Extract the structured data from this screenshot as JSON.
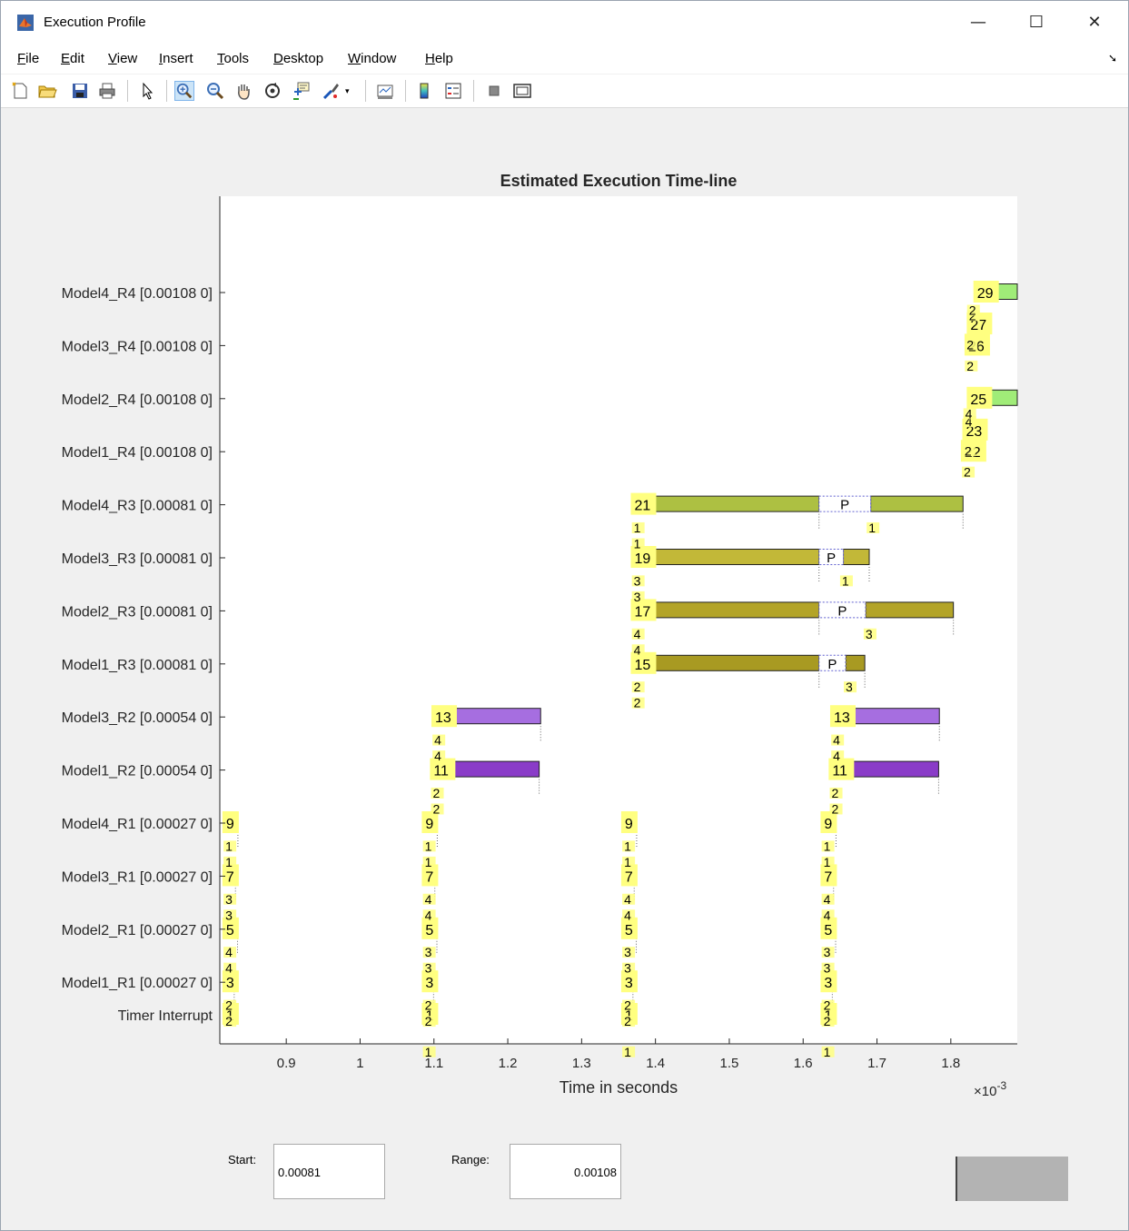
{
  "window": {
    "title": "Execution Profile",
    "controls": [
      "—",
      "☐",
      "✕"
    ]
  },
  "menu": [
    "File",
    "Edit",
    "View",
    "Insert",
    "Tools",
    "Desktop",
    "Window",
    "Help"
  ],
  "toolbar_icons": [
    "new-figure-icon",
    "open-file-icon",
    "save-icon",
    "print-icon",
    "edit-plot-icon",
    "zoom-in-icon",
    "zoom-out-icon",
    "pan-icon",
    "rotate-3d-icon",
    "data-cursor-icon",
    "brush-icon",
    "brush-dropdown-icon",
    "link-plot-icon",
    "insert-colorbar-icon",
    "insert-legend-icon",
    "hide-plot-tools-icon",
    "show-plot-tools-icon"
  ],
  "chart_data": {
    "type": "timeline",
    "title": "Estimated Execution Time-line",
    "xlabel": "Time in seconds",
    "x_multiplier": "×10^{-3}",
    "xlim": [
      0.81,
      1.89
    ],
    "xticks": [
      0.9,
      1,
      1.1,
      1.2,
      1.3,
      1.4,
      1.5,
      1.6,
      1.7,
      1.8
    ],
    "rows": [
      "Model4_R4 [0.00108 0]",
      "Model3_R4 [0.00108 0]",
      "Model2_R4 [0.00108 0]",
      "Model1_R4 [0.00108 0]",
      "Model4_R3 [0.00081 0]",
      "Model3_R3 [0.00081 0]",
      "Model2_R3 [0.00081 0]",
      "Model1_R3 [0.00081 0]",
      "Model3_R2 [0.00054 0]",
      "Model1_R2 [0.00054 0]",
      "Model4_R1 [0.00027 0]",
      "Model3_R1 [0.00027 0]",
      "Model2_R1 [0.00027 0]",
      "Model1_R1 [0.00027 0]",
      "Timer Interrupt"
    ],
    "colors": {
      "R1": "#b040a8",
      "R1b": "#8a3cc8",
      "R2": "#a66ee0",
      "R3a": "#a89a22",
      "R3b": "#b3a428",
      "R3c": "#c2b838",
      "R3d": "#adc042",
      "R4": "#a0ec78",
      "label_bg": "#ffff80"
    },
    "segments": [
      {
        "row": 10,
        "start": 0.8235,
        "end": 0.8345,
        "color": "R1b"
      },
      {
        "row": 11,
        "start": 0.8235,
        "end": 0.8312,
        "color": "R1"
      },
      {
        "row": 12,
        "start": 0.8235,
        "end": 0.834,
        "color": "R1"
      },
      {
        "row": 13,
        "start": 0.8235,
        "end": 0.8295,
        "color": "R1"
      },
      {
        "row": 10,
        "start": 1.0935,
        "end": 1.1045,
        "color": "R1b"
      },
      {
        "row": 11,
        "start": 1.0935,
        "end": 1.1012,
        "color": "R1"
      },
      {
        "row": 12,
        "start": 1.0935,
        "end": 1.104,
        "color": "R1"
      },
      {
        "row": 13,
        "start": 1.0935,
        "end": 1.0995,
        "color": "R1"
      },
      {
        "row": 9,
        "start": 1.104,
        "end": 1.2425,
        "color": "R1b"
      },
      {
        "row": 8,
        "start": 1.106,
        "end": 1.2445,
        "color": "R2"
      },
      {
        "row": 10,
        "start": 1.3635,
        "end": 1.3745,
        "color": "R1b"
      },
      {
        "row": 11,
        "start": 1.3635,
        "end": 1.3712,
        "color": "R1"
      },
      {
        "row": 12,
        "start": 1.3635,
        "end": 1.374,
        "color": "R1"
      },
      {
        "row": 13,
        "start": 1.3635,
        "end": 1.3695,
        "color": "R1"
      },
      {
        "row": 7,
        "start": 1.3765,
        "end": 1.6215,
        "color": "R3a"
      },
      {
        "row": 7,
        "start": 1.6575,
        "end": 1.6835,
        "color": "R3a"
      },
      {
        "row": 6,
        "start": 1.3765,
        "end": 1.6215,
        "color": "R3b"
      },
      {
        "row": 6,
        "start": 1.6845,
        "end": 1.8035,
        "color": "R3b"
      },
      {
        "row": 5,
        "start": 1.3765,
        "end": 1.6215,
        "color": "R3c"
      },
      {
        "row": 5,
        "start": 1.6545,
        "end": 1.6895,
        "color": "R3c"
      },
      {
        "row": 4,
        "start": 1.3765,
        "end": 1.6215,
        "color": "R3d"
      },
      {
        "row": 4,
        "start": 1.6915,
        "end": 1.8165,
        "color": "R3d"
      },
      {
        "row": 10,
        "start": 1.6335,
        "end": 1.6445,
        "color": "R1b"
      },
      {
        "row": 11,
        "start": 1.6335,
        "end": 1.6412,
        "color": "R1"
      },
      {
        "row": 12,
        "start": 1.6335,
        "end": 1.644,
        "color": "R1"
      },
      {
        "row": 13,
        "start": 1.6335,
        "end": 1.6395,
        "color": "R1"
      },
      {
        "row": 9,
        "start": 1.6445,
        "end": 1.7835,
        "color": "R1b"
      },
      {
        "row": 8,
        "start": 1.646,
        "end": 1.7845,
        "color": "R2"
      },
      {
        "row": 2,
        "start": 1.8405,
        "end": 1.89,
        "color": "R4"
      },
      {
        "row": 0,
        "start": 1.8505,
        "end": 1.89,
        "color": "R4"
      }
    ],
    "preempt_boxes": [
      {
        "row": 7,
        "start": 1.6215,
        "end": 1.6575,
        "label": "P"
      },
      {
        "row": 6,
        "start": 1.6215,
        "end": 1.6845,
        "label": "P"
      },
      {
        "row": 5,
        "start": 1.6215,
        "end": 1.6545,
        "label": "P"
      },
      {
        "row": 4,
        "start": 1.6215,
        "end": 1.6915,
        "label": "P"
      }
    ],
    "task_labels": [
      {
        "x": 0.8185,
        "yrow": 10,
        "text": "9"
      },
      {
        "x": 0.8185,
        "yrow": 11,
        "text": "7"
      },
      {
        "x": 0.8185,
        "yrow": 12,
        "text": "5"
      },
      {
        "x": 0.8185,
        "yrow": 13,
        "text": "3"
      },
      {
        "x": 0.8185,
        "yrow": 14,
        "text": "1"
      },
      {
        "x": 1.0885,
        "yrow": 10,
        "text": "9"
      },
      {
        "x": 1.0885,
        "yrow": 11,
        "text": "7"
      },
      {
        "x": 1.0885,
        "yrow": 12,
        "text": "5"
      },
      {
        "x": 1.0885,
        "yrow": 13,
        "text": "3"
      },
      {
        "x": 1.0885,
        "yrow": 14,
        "text": "1"
      },
      {
        "x": 1.0995,
        "yrow": 9,
        "text": "11"
      },
      {
        "x": 1.1015,
        "yrow": 8,
        "text": "13"
      },
      {
        "x": 1.3585,
        "yrow": 10,
        "text": "9"
      },
      {
        "x": 1.3585,
        "yrow": 11,
        "text": "7"
      },
      {
        "x": 1.3585,
        "yrow": 12,
        "text": "5"
      },
      {
        "x": 1.3585,
        "yrow": 13,
        "text": "3"
      },
      {
        "x": 1.3585,
        "yrow": 14,
        "text": "1"
      },
      {
        "x": 1.3715,
        "yrow": 7,
        "text": "15"
      },
      {
        "x": 1.3715,
        "yrow": 6,
        "text": "17"
      },
      {
        "x": 1.3715,
        "yrow": 5,
        "text": "19"
      },
      {
        "x": 1.3715,
        "yrow": 4,
        "text": "21"
      },
      {
        "x": 1.6285,
        "yrow": 10,
        "text": "9"
      },
      {
        "x": 1.6285,
        "yrow": 11,
        "text": "7"
      },
      {
        "x": 1.6285,
        "yrow": 12,
        "text": "5"
      },
      {
        "x": 1.6285,
        "yrow": 13,
        "text": "3"
      },
      {
        "x": 1.6285,
        "yrow": 14,
        "text": "1"
      },
      {
        "x": 1.6395,
        "yrow": 9,
        "text": "11"
      },
      {
        "x": 1.6415,
        "yrow": 8,
        "text": "13"
      },
      {
        "x": 1.8185,
        "yrow": 3.0,
        "text": "22"
      },
      {
        "x": 1.8205,
        "yrow": 2.6,
        "text": "23"
      },
      {
        "x": 1.8265,
        "yrow": 2.0,
        "text": "25"
      },
      {
        "x": 1.8235,
        "yrow": 1.0,
        "text": "26"
      },
      {
        "x": 1.8265,
        "yrow": 0.6,
        "text": "27"
      },
      {
        "x": 1.8355,
        "yrow": 0.0,
        "text": "29"
      }
    ],
    "sub_labels": [
      {
        "x": 0.8175,
        "yrow": 10.4,
        "text": "1"
      },
      {
        "x": 0.8175,
        "yrow": 11.4,
        "text": "3"
      },
      {
        "x": 0.8175,
        "yrow": 12.4,
        "text": "4"
      },
      {
        "x": 0.8175,
        "yrow": 13.4,
        "text": "2"
      },
      {
        "x": 0.8175,
        "yrow": 10.7,
        "text": "1"
      },
      {
        "x": 0.8175,
        "yrow": 11.7,
        "text": "3"
      },
      {
        "x": 0.8175,
        "yrow": 12.7,
        "text": "4"
      },
      {
        "x": 0.8175,
        "yrow": 13.7,
        "text": "2"
      },
      {
        "x": 1.0875,
        "yrow": 10.4,
        "text": "1"
      },
      {
        "x": 1.0875,
        "yrow": 11.4,
        "text": "4"
      },
      {
        "x": 1.0875,
        "yrow": 12.4,
        "text": "3"
      },
      {
        "x": 1.0875,
        "yrow": 13.4,
        "text": "2"
      },
      {
        "x": 1.0875,
        "yrow": 10.7,
        "text": "1"
      },
      {
        "x": 1.0875,
        "yrow": 11.7,
        "text": "4"
      },
      {
        "x": 1.0875,
        "yrow": 12.7,
        "text": "3"
      },
      {
        "x": 1.0875,
        "yrow": 13.7,
        "text": "2"
      },
      {
        "x": 1.0875,
        "yrow": 14.4,
        "text": "1"
      },
      {
        "x": 1.0985,
        "yrow": 9.4,
        "text": "2"
      },
      {
        "x": 1.0985,
        "yrow": 9.7,
        "text": "2"
      },
      {
        "x": 1.1005,
        "yrow": 8.4,
        "text": "4"
      },
      {
        "x": 1.1005,
        "yrow": 8.7,
        "text": "4"
      },
      {
        "x": 1.3575,
        "yrow": 10.4,
        "text": "1"
      },
      {
        "x": 1.3575,
        "yrow": 11.4,
        "text": "4"
      },
      {
        "x": 1.3575,
        "yrow": 12.4,
        "text": "3"
      },
      {
        "x": 1.3575,
        "yrow": 13.4,
        "text": "2"
      },
      {
        "x": 1.3575,
        "yrow": 10.7,
        "text": "1"
      },
      {
        "x": 1.3575,
        "yrow": 11.7,
        "text": "4"
      },
      {
        "x": 1.3575,
        "yrow": 12.7,
        "text": "3"
      },
      {
        "x": 1.3575,
        "yrow": 13.7,
        "text": "2"
      },
      {
        "x": 1.3575,
        "yrow": 14.4,
        "text": "1"
      },
      {
        "x": 1.3705,
        "yrow": 7.4,
        "text": "2"
      },
      {
        "x": 1.3705,
        "yrow": 7.7,
        "text": "2"
      },
      {
        "x": 1.3705,
        "yrow": 6.4,
        "text": "4"
      },
      {
        "x": 1.3705,
        "yrow": 6.7,
        "text": "4"
      },
      {
        "x": 1.3705,
        "yrow": 5.4,
        "text": "3"
      },
      {
        "x": 1.3705,
        "yrow": 5.7,
        "text": "3"
      },
      {
        "x": 1.3705,
        "yrow": 4.4,
        "text": "1"
      },
      {
        "x": 1.3705,
        "yrow": 4.7,
        "text": "1"
      },
      {
        "x": 1.6275,
        "yrow": 10.4,
        "text": "1"
      },
      {
        "x": 1.6275,
        "yrow": 11.4,
        "text": "4"
      },
      {
        "x": 1.6275,
        "yrow": 12.4,
        "text": "3"
      },
      {
        "x": 1.6275,
        "yrow": 13.4,
        "text": "2"
      },
      {
        "x": 1.6275,
        "yrow": 10.7,
        "text": "1"
      },
      {
        "x": 1.6275,
        "yrow": 11.7,
        "text": "4"
      },
      {
        "x": 1.6275,
        "yrow": 12.7,
        "text": "3"
      },
      {
        "x": 1.6275,
        "yrow": 13.7,
        "text": "2"
      },
      {
        "x": 1.6275,
        "yrow": 14.4,
        "text": "1"
      },
      {
        "x": 1.6385,
        "yrow": 9.4,
        "text": "2"
      },
      {
        "x": 1.6385,
        "yrow": 9.7,
        "text": "2"
      },
      {
        "x": 1.6405,
        "yrow": 8.4,
        "text": "4"
      },
      {
        "x": 1.6405,
        "yrow": 8.7,
        "text": "4"
      },
      {
        "x": 1.6575,
        "yrow": 7.4,
        "text": "3"
      },
      {
        "x": 1.6845,
        "yrow": 6.4,
        "text": "3"
      },
      {
        "x": 1.6525,
        "yrow": 5.4,
        "text": "1"
      },
      {
        "x": 1.6885,
        "yrow": 4.4,
        "text": "1"
      },
      {
        "x": 1.8175,
        "yrow": 3.35,
        "text": "2"
      },
      {
        "x": 1.8185,
        "yrow": 2.95,
        "text": "2"
      },
      {
        "x": 1.8195,
        "yrow": 2.4,
        "text": "4"
      },
      {
        "x": 1.8195,
        "yrow": 2.25,
        "text": "4"
      },
      {
        "x": 1.8215,
        "yrow": 1.35,
        "text": "2"
      },
      {
        "x": 1.8215,
        "yrow": 0.95,
        "text": "2"
      },
      {
        "x": 1.8245,
        "yrow": 0.4,
        "text": "2"
      },
      {
        "x": 1.8245,
        "yrow": 0.3,
        "text": "2"
      }
    ]
  },
  "controls": {
    "start_label": "Start:",
    "start_value": "0.00081",
    "range_label": "Range:",
    "range_value": "0.00108"
  }
}
